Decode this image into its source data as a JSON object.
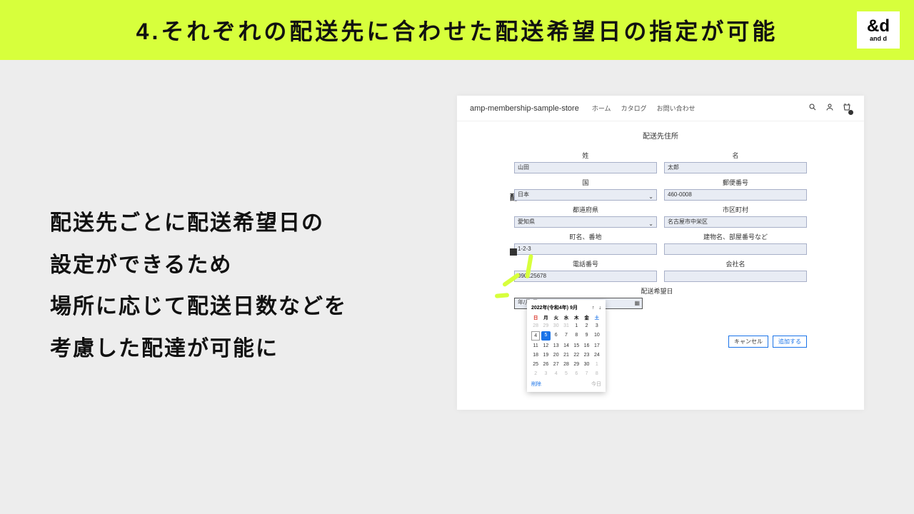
{
  "header": {
    "title": "4.それぞれの配送先に合わせた配送希望日の指定が可能"
  },
  "logo": {
    "mark": "&d",
    "sub": "and d"
  },
  "description": "配送先ごとに配送希望日の\n設定ができるため\n場所に応じて配送日数などを\n考慮した配達が可能に",
  "store": {
    "name": "amp-membership-sample-store",
    "nav": [
      "ホーム",
      "カタログ",
      "お問い合わせ"
    ]
  },
  "form": {
    "section_title": "配送先住所",
    "lastname_label": "姓",
    "lastname": "山田",
    "firstname_label": "名",
    "firstname": "太郎",
    "country_label": "国",
    "country": "日本",
    "zip_label": "郵便番号",
    "zip": "460-0008",
    "pref_label": "都道府県",
    "pref": "愛知県",
    "city_label": "市区町村",
    "city": "名古屋市中栄区",
    "street_label": "町名、番地",
    "street": "1-2-3",
    "building_label": "建物名、部屋番号など",
    "building": "",
    "phone_label": "電話番号",
    "phone": "090125678",
    "company_label": "会社名",
    "company": "",
    "date_label": "配送希望日",
    "date_placeholder": "年/月/日",
    "cancel": "キャンセル",
    "add": "追加する"
  },
  "calendar": {
    "title": "2022年(令和4年) 9月",
    "dow": [
      "日",
      "月",
      "火",
      "水",
      "木",
      "金",
      "土"
    ],
    "prev_month": [
      "28",
      "29",
      "30",
      "31"
    ],
    "days": [
      "1",
      "2",
      "3",
      "4",
      "5",
      "6",
      "7",
      "8",
      "9",
      "10",
      "11",
      "12",
      "13",
      "14",
      "15",
      "16",
      "17",
      "18",
      "19",
      "20",
      "21",
      "22",
      "23",
      "24",
      "25",
      "26",
      "27",
      "28",
      "29",
      "30"
    ],
    "next_month": [
      "1",
      "2",
      "3",
      "4",
      "5",
      "6",
      "7",
      "8"
    ],
    "today_idx": 4,
    "selected_idx": 5,
    "delete": "削除",
    "today_link": "今日"
  }
}
